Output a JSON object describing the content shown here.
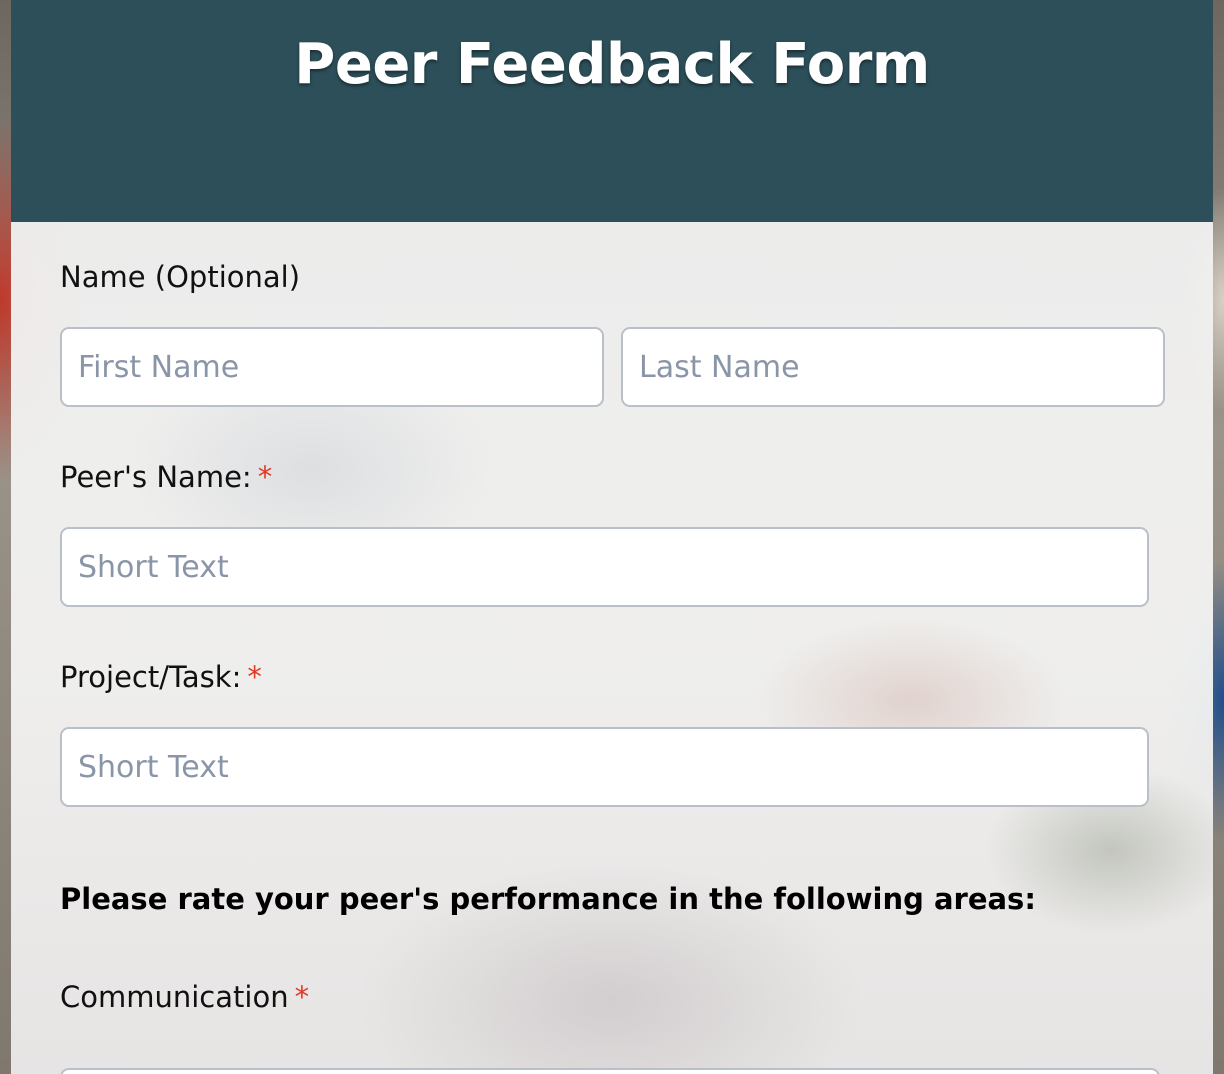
{
  "form": {
    "title": "Peer Feedback Form"
  },
  "fields": {
    "name": {
      "label": "Name (Optional)",
      "first_placeholder": "First Name",
      "last_placeholder": "Last Name"
    },
    "peer_name": {
      "label": "Peer's Name:",
      "required_mark": "*",
      "placeholder": "Short Text"
    },
    "project_task": {
      "label": "Project/Task:",
      "required_mark": "*",
      "placeholder": "Short Text"
    }
  },
  "rating_section": {
    "heading": "Please rate your peer's performance in the following areas:",
    "communication": {
      "label": "Communication",
      "required_mark": "*"
    }
  },
  "colors": {
    "header_bg": "#2c4f59",
    "required": "#e03a27",
    "placeholder": "#8a96a8",
    "input_border": "#b9c0ca"
  }
}
